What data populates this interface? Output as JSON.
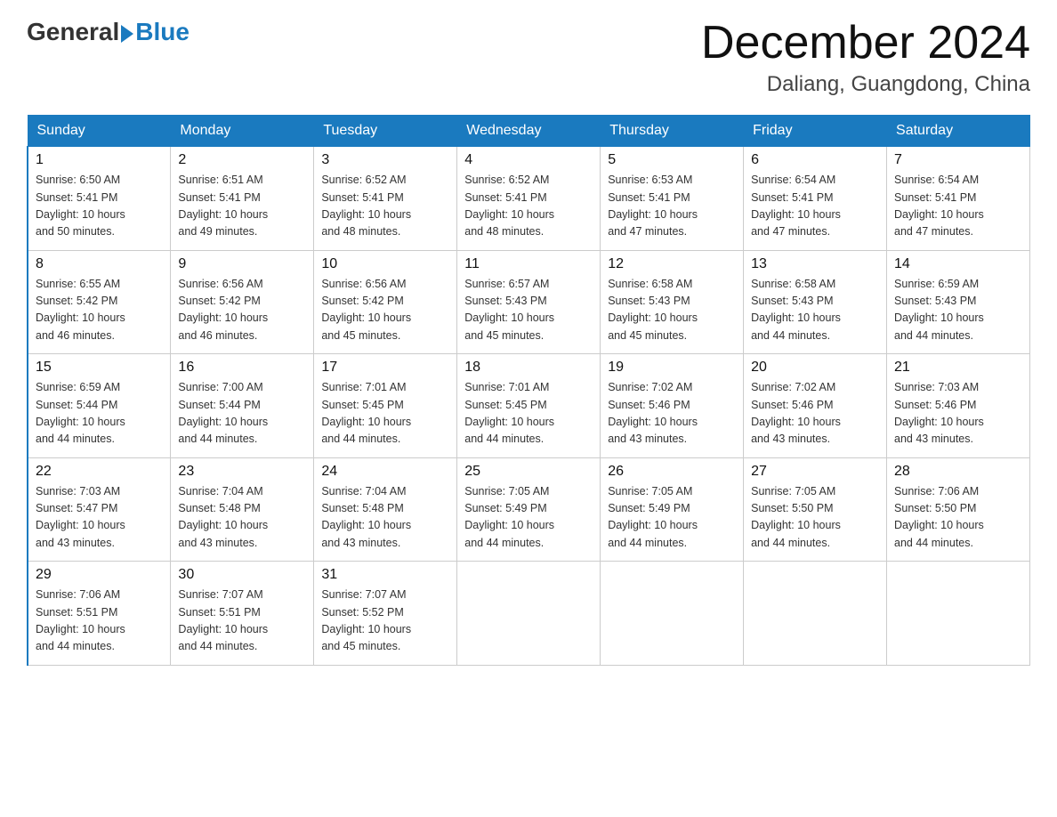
{
  "header": {
    "logo_general": "General",
    "logo_blue": "Blue",
    "title": "December 2024",
    "subtitle": "Daliang, Guangdong, China"
  },
  "days_of_week": [
    "Sunday",
    "Monday",
    "Tuesday",
    "Wednesday",
    "Thursday",
    "Friday",
    "Saturday"
  ],
  "weeks": [
    [
      {
        "day": "1",
        "info": "Sunrise: 6:50 AM\nSunset: 5:41 PM\nDaylight: 10 hours\nand 50 minutes."
      },
      {
        "day": "2",
        "info": "Sunrise: 6:51 AM\nSunset: 5:41 PM\nDaylight: 10 hours\nand 49 minutes."
      },
      {
        "day": "3",
        "info": "Sunrise: 6:52 AM\nSunset: 5:41 PM\nDaylight: 10 hours\nand 48 minutes."
      },
      {
        "day": "4",
        "info": "Sunrise: 6:52 AM\nSunset: 5:41 PM\nDaylight: 10 hours\nand 48 minutes."
      },
      {
        "day": "5",
        "info": "Sunrise: 6:53 AM\nSunset: 5:41 PM\nDaylight: 10 hours\nand 47 minutes."
      },
      {
        "day": "6",
        "info": "Sunrise: 6:54 AM\nSunset: 5:41 PM\nDaylight: 10 hours\nand 47 minutes."
      },
      {
        "day": "7",
        "info": "Sunrise: 6:54 AM\nSunset: 5:41 PM\nDaylight: 10 hours\nand 47 minutes."
      }
    ],
    [
      {
        "day": "8",
        "info": "Sunrise: 6:55 AM\nSunset: 5:42 PM\nDaylight: 10 hours\nand 46 minutes."
      },
      {
        "day": "9",
        "info": "Sunrise: 6:56 AM\nSunset: 5:42 PM\nDaylight: 10 hours\nand 46 minutes."
      },
      {
        "day": "10",
        "info": "Sunrise: 6:56 AM\nSunset: 5:42 PM\nDaylight: 10 hours\nand 45 minutes."
      },
      {
        "day": "11",
        "info": "Sunrise: 6:57 AM\nSunset: 5:43 PM\nDaylight: 10 hours\nand 45 minutes."
      },
      {
        "day": "12",
        "info": "Sunrise: 6:58 AM\nSunset: 5:43 PM\nDaylight: 10 hours\nand 45 minutes."
      },
      {
        "day": "13",
        "info": "Sunrise: 6:58 AM\nSunset: 5:43 PM\nDaylight: 10 hours\nand 44 minutes."
      },
      {
        "day": "14",
        "info": "Sunrise: 6:59 AM\nSunset: 5:43 PM\nDaylight: 10 hours\nand 44 minutes."
      }
    ],
    [
      {
        "day": "15",
        "info": "Sunrise: 6:59 AM\nSunset: 5:44 PM\nDaylight: 10 hours\nand 44 minutes."
      },
      {
        "day": "16",
        "info": "Sunrise: 7:00 AM\nSunset: 5:44 PM\nDaylight: 10 hours\nand 44 minutes."
      },
      {
        "day": "17",
        "info": "Sunrise: 7:01 AM\nSunset: 5:45 PM\nDaylight: 10 hours\nand 44 minutes."
      },
      {
        "day": "18",
        "info": "Sunrise: 7:01 AM\nSunset: 5:45 PM\nDaylight: 10 hours\nand 44 minutes."
      },
      {
        "day": "19",
        "info": "Sunrise: 7:02 AM\nSunset: 5:46 PM\nDaylight: 10 hours\nand 43 minutes."
      },
      {
        "day": "20",
        "info": "Sunrise: 7:02 AM\nSunset: 5:46 PM\nDaylight: 10 hours\nand 43 minutes."
      },
      {
        "day": "21",
        "info": "Sunrise: 7:03 AM\nSunset: 5:46 PM\nDaylight: 10 hours\nand 43 minutes."
      }
    ],
    [
      {
        "day": "22",
        "info": "Sunrise: 7:03 AM\nSunset: 5:47 PM\nDaylight: 10 hours\nand 43 minutes."
      },
      {
        "day": "23",
        "info": "Sunrise: 7:04 AM\nSunset: 5:48 PM\nDaylight: 10 hours\nand 43 minutes."
      },
      {
        "day": "24",
        "info": "Sunrise: 7:04 AM\nSunset: 5:48 PM\nDaylight: 10 hours\nand 43 minutes."
      },
      {
        "day": "25",
        "info": "Sunrise: 7:05 AM\nSunset: 5:49 PM\nDaylight: 10 hours\nand 44 minutes."
      },
      {
        "day": "26",
        "info": "Sunrise: 7:05 AM\nSunset: 5:49 PM\nDaylight: 10 hours\nand 44 minutes."
      },
      {
        "day": "27",
        "info": "Sunrise: 7:05 AM\nSunset: 5:50 PM\nDaylight: 10 hours\nand 44 minutes."
      },
      {
        "day": "28",
        "info": "Sunrise: 7:06 AM\nSunset: 5:50 PM\nDaylight: 10 hours\nand 44 minutes."
      }
    ],
    [
      {
        "day": "29",
        "info": "Sunrise: 7:06 AM\nSunset: 5:51 PM\nDaylight: 10 hours\nand 44 minutes."
      },
      {
        "day": "30",
        "info": "Sunrise: 7:07 AM\nSunset: 5:51 PM\nDaylight: 10 hours\nand 44 minutes."
      },
      {
        "day": "31",
        "info": "Sunrise: 7:07 AM\nSunset: 5:52 PM\nDaylight: 10 hours\nand 45 minutes."
      },
      {
        "day": "",
        "info": ""
      },
      {
        "day": "",
        "info": ""
      },
      {
        "day": "",
        "info": ""
      },
      {
        "day": "",
        "info": ""
      }
    ]
  ]
}
